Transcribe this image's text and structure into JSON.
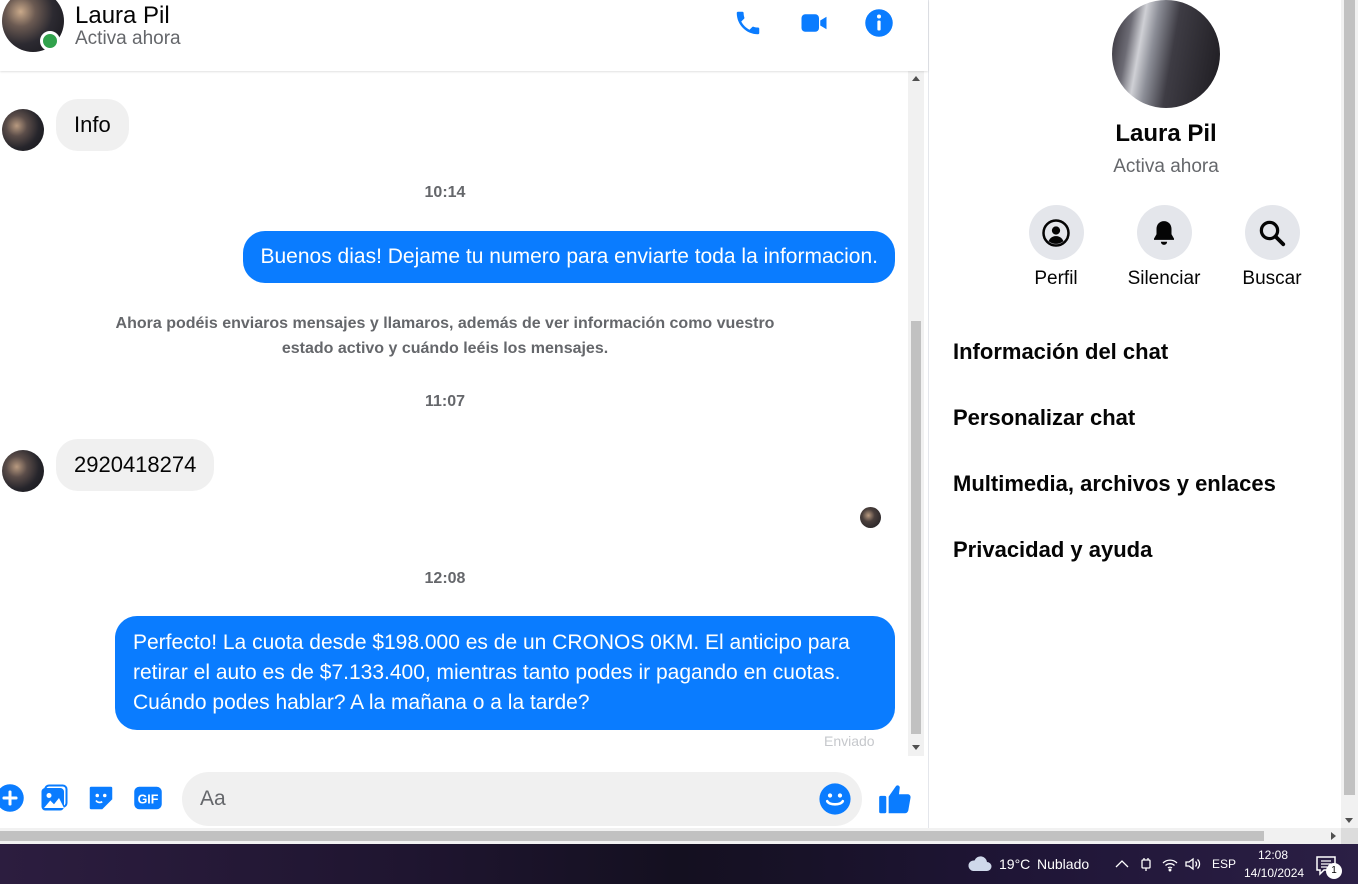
{
  "header": {
    "name": "Laura Pil",
    "status": "Activa ahora",
    "actions": [
      "phone-icon",
      "video-icon",
      "info-icon"
    ]
  },
  "messages": {
    "incoming_1": "Info",
    "time_1": "10:14",
    "outgoing_1": "Buenos dias! Dejame tu numero para enviarte toda la informacion.",
    "system_note": "Ahora podéis enviaros mensajes y llamaros, además de ver información como vuestro estado activo y cuándo leéis los mensajes.",
    "time_2": "11:07",
    "incoming_2": "2920418274",
    "time_3": "12:08",
    "outgoing_2": "Perfecto! La cuota desde $198.000 es de un CRONOS 0KM. El anticipo para retirar el auto es de $7.133.400, mientras tanto podes ir pagando en cuotas. Cuándo podes hablar? A la mañana o a la tarde?",
    "sent_status": "Enviado"
  },
  "composer": {
    "placeholder": "Aa",
    "icons": [
      "plus-icon",
      "image-icon",
      "sticker-icon",
      "gif-icon",
      "emoji-icon",
      "thumbs-up-icon"
    ],
    "gif_label": "GIF"
  },
  "info_panel": {
    "name": "Laura Pil",
    "status": "Activa ahora",
    "actions": [
      {
        "label": "Perfil",
        "icon": "profile-icon"
      },
      {
        "label": "Silenciar",
        "icon": "bell-icon"
      },
      {
        "label": "Buscar",
        "icon": "search-icon"
      }
    ],
    "menu": [
      "Información del chat",
      "Personalizar chat",
      "Multimedia, archivos y enlaces",
      "Privacidad y ayuda"
    ]
  },
  "taskbar": {
    "temperature": "19°C",
    "condition": "Nublado",
    "language": "ESP",
    "time": "12:08",
    "date": "14/10/2024",
    "notification_count": "1"
  },
  "colors": {
    "accent": "#0a7cff",
    "online": "#31a24c",
    "incoming_bubble": "#f0f0f0",
    "muted_text": "#65676b"
  }
}
